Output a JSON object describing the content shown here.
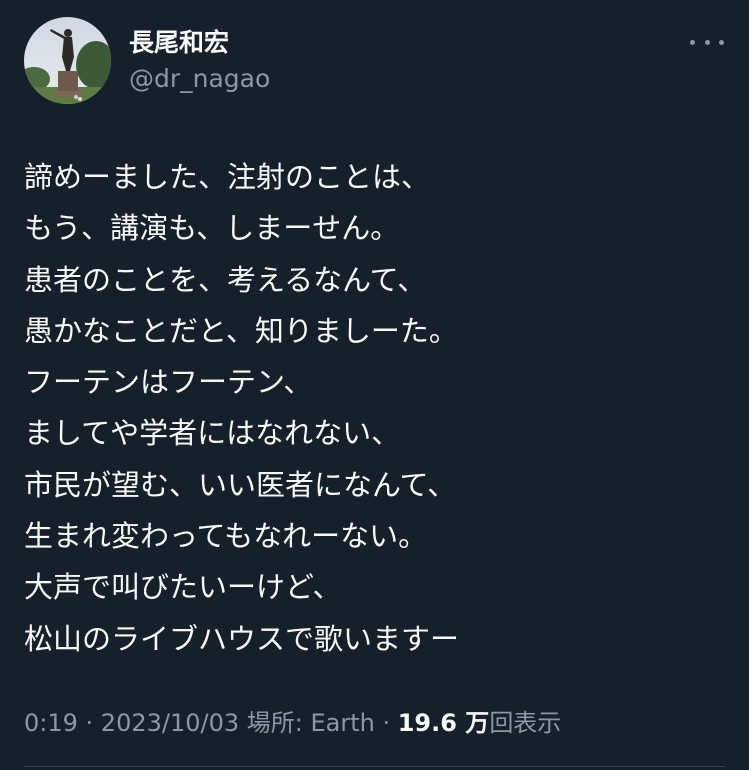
{
  "author": {
    "display_name": "長尾和宏",
    "handle": "@dr_nagao"
  },
  "tweet": {
    "lines": [
      "諦めーました、注射のことは、",
      "もう、講演も、しまーせん。",
      "患者のことを、考えるなんて、",
      "愚かなことだと、知りましーた。",
      "フーテンはフーテン、",
      "ましてや学者にはなれない、",
      "市民が望む、いい医者になんて、",
      "生まれ変わってもなれーない。",
      "大声で叫びたいーけど、",
      "松山のライブハウスで歌いますー"
    ]
  },
  "meta": {
    "time": "0:19",
    "separator": " · ",
    "date": "2023/10/03",
    "location": "場所: Earth",
    "views_count": "19.6 万",
    "views_label": "回表示"
  },
  "icons": {
    "more": "more-horizontal-icon"
  },
  "colors": {
    "background": "#15202b",
    "primary_text": "#f7f9f9",
    "secondary_text": "#8b98a5"
  }
}
